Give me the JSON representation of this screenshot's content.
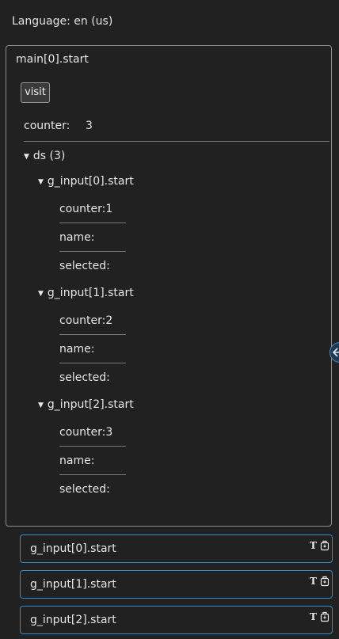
{
  "language_label": "Language: en (us)",
  "main": {
    "title": "main[0].start",
    "visit_label": "visit",
    "counter_label": "counter:",
    "counter_value": "3",
    "ds_label": "ds (3)",
    "groups": [
      {
        "title": "g_input[0].start",
        "fields": [
          "counter:1",
          "name:",
          "selected:"
        ]
      },
      {
        "title": "g_input[1].start",
        "fields": [
          "counter:2",
          "name:",
          "selected:"
        ]
      },
      {
        "title": "g_input[2].start",
        "fields": [
          "counter:3",
          "name:",
          "selected:"
        ]
      }
    ]
  },
  "cards": [
    {
      "label": "g_input[0].start",
      "t_icon": "T"
    },
    {
      "label": "g_input[1].start",
      "t_icon": "T"
    },
    {
      "label": "g_input[2].start",
      "t_icon": "T"
    }
  ],
  "icons": {
    "caret": "caret-down-icon",
    "handle": "collapse-arrow-icon",
    "card_text": "text-format-icon",
    "card_copy": "copy-icon"
  },
  "colors": {
    "accent": "#2e8fc9",
    "background": "#212121",
    "border": "#8c8c8c"
  }
}
